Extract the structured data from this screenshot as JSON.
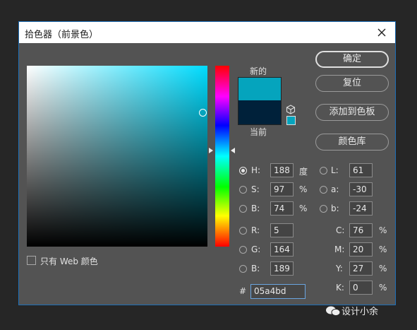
{
  "window": {
    "title": "拾色器（前景色）",
    "close_icon": "close-icon"
  },
  "swatches": {
    "new_label": "新的",
    "current_label": "当前",
    "new_color": "#05a4bd",
    "current_color": "#00213a"
  },
  "buttons": {
    "ok": "确定",
    "reset": "复位",
    "add_to_swatches": "添加到色板",
    "color_libraries": "颜色库"
  },
  "hsb": {
    "h": {
      "label": "H:",
      "value": "188",
      "unit": "度"
    },
    "s": {
      "label": "S:",
      "value": "97",
      "unit": "%"
    },
    "b": {
      "label": "B:",
      "value": "74",
      "unit": "%"
    }
  },
  "rgb": {
    "r": {
      "label": "R:",
      "value": "5"
    },
    "g": {
      "label": "G:",
      "value": "164"
    },
    "b": {
      "label": "B:",
      "value": "189"
    }
  },
  "lab": {
    "l": {
      "label": "L:",
      "value": "61"
    },
    "a": {
      "label": "a:",
      "value": "-30"
    },
    "b": {
      "label": "b:",
      "value": "-24"
    }
  },
  "cmyk": {
    "c": {
      "label": "C:",
      "value": "76",
      "unit": "%"
    },
    "m": {
      "label": "M:",
      "value": "20",
      "unit": "%"
    },
    "y": {
      "label": "Y:",
      "value": "27",
      "unit": "%"
    },
    "k": {
      "label": "K:",
      "value": "0",
      "unit": "%"
    }
  },
  "hex": {
    "prefix": "#",
    "value": "05a4bd"
  },
  "web_only": {
    "label": "只有 Web 颜色",
    "checked": false
  },
  "watermark": {
    "text": "设计小余"
  }
}
